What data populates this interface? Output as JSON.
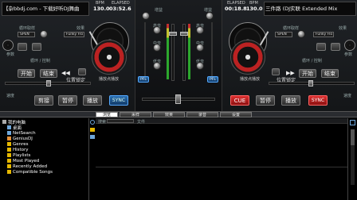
{
  "deck_left": {
    "title": "【杂bbdj.com - 下载好听DJ舞曲",
    "bpm_label": "BPM",
    "bpm_value": "130.0",
    "elapsed_label": "ELAPSED",
    "elapsed_value": "03:52.6",
    "loop_label": "循环取样",
    "loop_select": "SPEN",
    "effect_select": "Funky Flo",
    "effect_label": "效果",
    "params_label": "参数",
    "loop_ctrl_label": "循环 / 控制",
    "start_button": "开始",
    "end_button": "结束",
    "position_label": "位置",
    "lock_label": "锁定",
    "pitch_label": "速度",
    "cue_button": "剪接",
    "pause_button": "暂停",
    "play_button": "播放",
    "sync_button": "SYNC",
    "cue_points_label": "播放点播放"
  },
  "deck_right": {
    "title": "三件路 (DJ实联 Extended Mix",
    "bpm_label": "BPM",
    "bpm_value": "130.0",
    "elapsed_label": "ELAPSED",
    "elapsed_value": "00:18.8",
    "loop_label": "循环取样",
    "loop_select": "SPEN",
    "effect_select": "Funky Flo",
    "effect_label": "效果",
    "params_label": "参数",
    "loop_ctrl_label": "循环 / 控制",
    "start_button": "开始",
    "end_button": "结束",
    "position_label": "位置",
    "lock_label": "锁定",
    "pitch_label": "速度",
    "cue_button": "CUE",
    "pause_button": "暂停",
    "play_button": "播放",
    "sync_button": "SYNC",
    "cue_points_label": "播放点播放"
  },
  "mixer": {
    "gain_label": "增益",
    "high_label": "高音",
    "mid_label": "中音",
    "low_label": "低音",
    "pfl_left": "PFL",
    "pfl_right": "PFL"
  },
  "browser": {
    "tabs": [
      "浏览",
      "采样",
      "效果",
      "录音",
      "设置"
    ],
    "tree": [
      {
        "label": "我的电脑",
        "icon": "computer-icon",
        "color": "#aaaaaa"
      },
      {
        "label": "桌面",
        "icon": "desktop-icon",
        "color": "#6fa8dc"
      },
      {
        "label": "NetSearch",
        "icon": "netsearch-icon",
        "color": "#6fa8dc"
      },
      {
        "label": "GeniusDJ",
        "icon": "geniusdj-icon",
        "color": "#e69138"
      },
      {
        "label": "Genres",
        "icon": "genres-icon",
        "color": "#e6b800"
      },
      {
        "label": "History",
        "icon": "history-icon",
        "color": "#e6b800"
      },
      {
        "label": "Playlists",
        "icon": "playlists-icon",
        "color": "#e6b800"
      },
      {
        "label": "Most Played",
        "icon": "most-played-icon",
        "color": "#e6b800"
      },
      {
        "label": "Recently Added",
        "icon": "recently-added-icon",
        "color": "#e6b800"
      },
      {
        "label": "Compatible Songs",
        "icon": "compatible-songs-icon",
        "color": "#e6b800"
      }
    ],
    "search_label": "搜索",
    "files_label": "文件"
  }
}
